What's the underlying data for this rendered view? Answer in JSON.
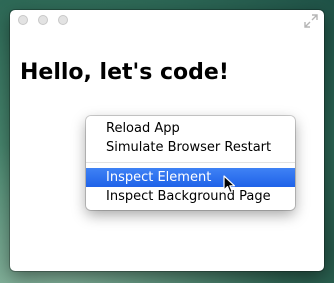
{
  "heading": "Hello, let's code!",
  "window_controls": {
    "close_icon": "close-icon",
    "minimize_icon": "minimize-icon",
    "zoom_icon": "zoom-icon",
    "fullscreen_icon": "fullscreen-toggle-icon"
  },
  "context_menu": {
    "items": [
      {
        "label": "Reload App",
        "highlighted": false
      },
      {
        "label": "Simulate Browser Restart",
        "highlighted": false
      },
      {
        "label": "Inspect Element",
        "highlighted": true
      },
      {
        "label": "Inspect Background Page",
        "highlighted": false
      }
    ],
    "highlight_color": "#3478f6"
  },
  "cursor_icon": "arrow-pointer-icon"
}
